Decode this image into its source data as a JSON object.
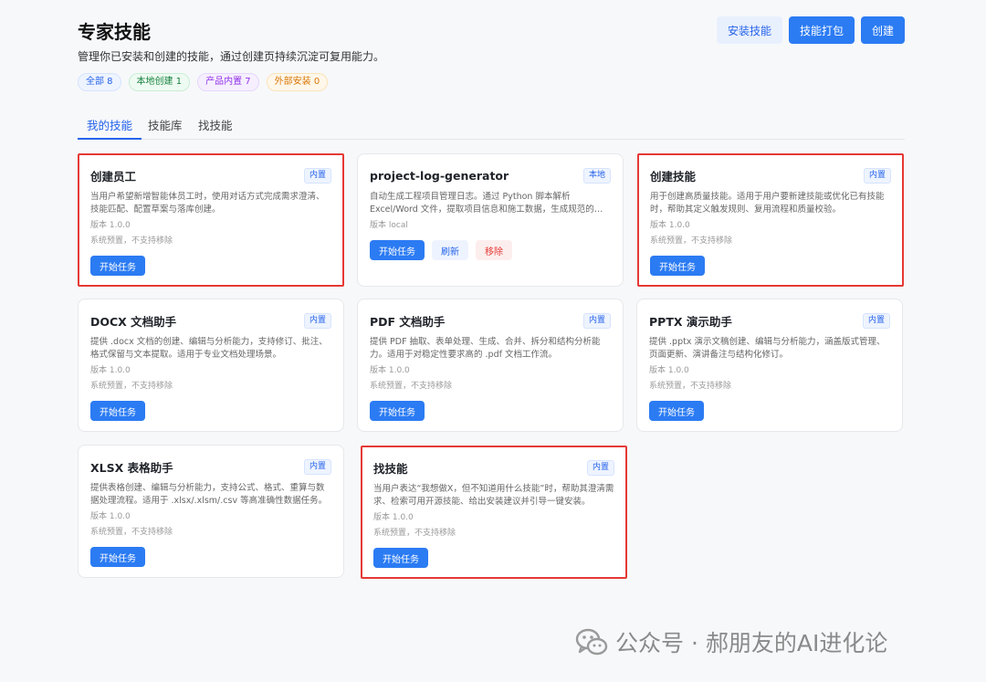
{
  "header": {
    "title": "专家技能",
    "subtitle": "管理你已安装和创建的技能，通过创建页持续沉淀可复用能力。"
  },
  "filters": [
    {
      "label": "全部 8"
    },
    {
      "label": "本地创建 1"
    },
    {
      "label": "产品内置 7"
    },
    {
      "label": "外部安装 0"
    }
  ],
  "actions": {
    "install": "安装技能",
    "package": "技能打包",
    "create": "创建"
  },
  "tabs": [
    {
      "label": "我的技能",
      "active": true
    },
    {
      "label": "技能库"
    },
    {
      "label": "找技能"
    }
  ],
  "cards": [
    {
      "title": "创建员工",
      "badge": "内置",
      "desc": "当用户希望新增智能体员工时，使用对话方式完成需求澄清、技能匹配、配置草案与落库创建。",
      "version": "版本 1.0.0",
      "note": "系统预置，不支持移除",
      "start": "开始任务"
    },
    {
      "title": "project-log-generator",
      "badge": "本地",
      "desc": "自动生成工程项目管理日志。通过 Python 脚本解析 Excel/Word 文件，提取项目信息和施工数据，生成规范的项目管理日志。",
      "version": "版本 local",
      "start": "开始任务",
      "refresh": "刷新",
      "remove": "移除"
    },
    {
      "title": "创建技能",
      "badge": "内置",
      "desc": "用于创建高质量技能。适用于用户要新建技能或优化已有技能时，帮助其定义触发规则、复用流程和质量校验。",
      "version": "版本 1.0.0",
      "note": "系统预置，不支持移除",
      "start": "开始任务"
    },
    {
      "title": "DOCX 文档助手",
      "badge": "内置",
      "desc": "提供 .docx 文档的创建、编辑与分析能力，支持修订、批注、格式保留与文本提取。适用于专业文档处理场景。",
      "version": "版本 1.0.0",
      "note": "系统预置，不支持移除",
      "start": "开始任务"
    },
    {
      "title": "PDF 文档助手",
      "badge": "内置",
      "desc": "提供 PDF 抽取、表单处理、生成、合并、拆分和结构分析能力。适用于对稳定性要求高的 .pdf 文档工作流。",
      "version": "版本 1.0.0",
      "note": "系统预置，不支持移除",
      "start": "开始任务"
    },
    {
      "title": "PPTX 演示助手",
      "badge": "内置",
      "desc": "提供 .pptx 演示文稿创建、编辑与分析能力，涵盖版式管理、页面更新、演讲备注与结构化修订。",
      "version": "版本 1.0.0",
      "note": "系统预置，不支持移除",
      "start": "开始任务"
    },
    {
      "title": "XLSX 表格助手",
      "badge": "内置",
      "desc": "提供表格创建、编辑与分析能力，支持公式、格式、重算与数据处理流程。适用于 .xlsx/.xlsm/.csv 等高准确性数据任务。",
      "version": "版本 1.0.0",
      "note": "系统预置，不支持移除",
      "start": "开始任务"
    },
    {
      "title": "找技能",
      "badge": "内置",
      "desc": "当用户表达“我想做X，但不知道用什么技能”时，帮助其澄清需求、检索可用开源技能、给出安装建议并引导一键安装。",
      "version": "版本 1.0.0",
      "note": "系统预置，不支持移除",
      "start": "开始任务"
    }
  ],
  "watermark": {
    "text": "公众号 · 郝朋友的AI进化论",
    "icon": "wechat-icon"
  }
}
